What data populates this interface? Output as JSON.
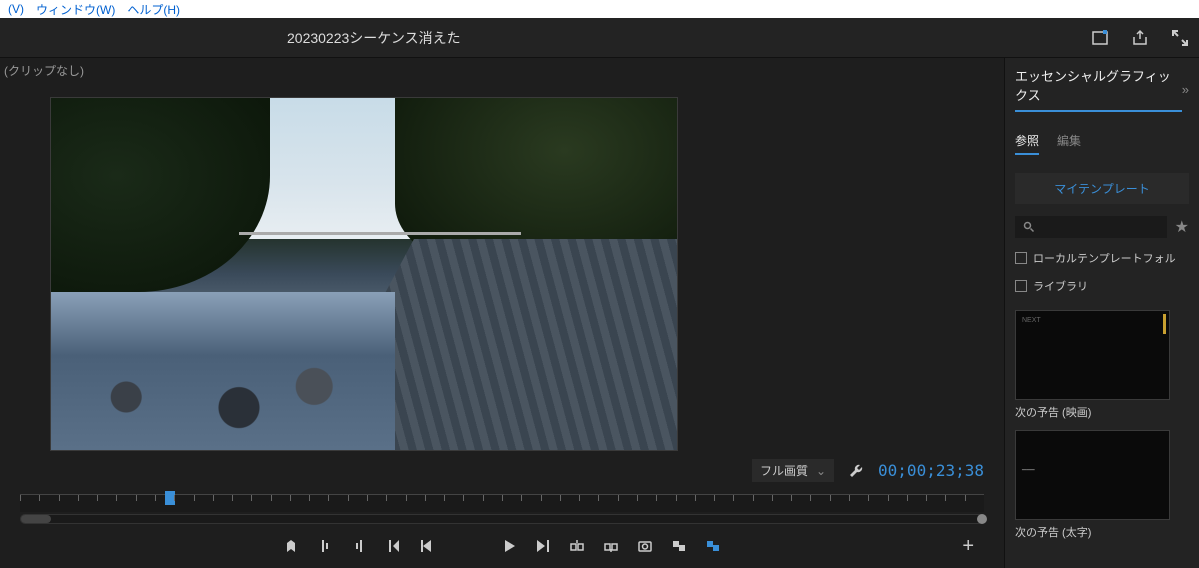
{
  "menu": {
    "view": "(V)",
    "window": "ウィンドウ(W)",
    "help": "ヘルプ(H)"
  },
  "header": {
    "project_title": "20230223シーケンス消えた"
  },
  "viewer": {
    "clip_label": "(クリップなし)",
    "quality": "フル画質",
    "timecode": "00;00;23;38"
  },
  "right_panel": {
    "title": "エッセンシャルグラフィックス",
    "tabs": {
      "browse": "参照",
      "edit": "編集"
    },
    "my_templates": "マイテンプレート",
    "search_placeholder": "",
    "checkboxes": {
      "local": "ローカルテンプレートフォル",
      "library": "ライブラリ"
    },
    "templates": [
      {
        "label": "次の予告 (映画)"
      },
      {
        "label": "次の予告 (太字)"
      }
    ]
  },
  "icons": {
    "share": "share",
    "fullscreen": "fullscreen",
    "quick_export": "quick-export"
  }
}
